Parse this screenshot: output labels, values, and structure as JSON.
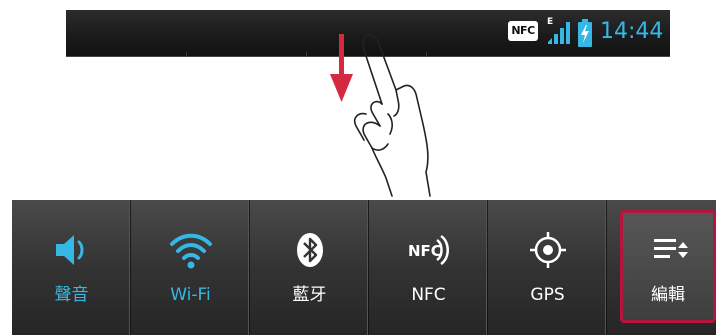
{
  "status_bar": {
    "nfc_label": "NFC",
    "network_type": "E",
    "time": "14:44",
    "accent": "#35b8e6",
    "icons": [
      "nfc-icon",
      "signal-icon",
      "battery-charging-icon"
    ]
  },
  "gesture": {
    "icons": [
      "down-arrow-icon",
      "hand-swipe-icon"
    ],
    "arrow_color": "#d6283f"
  },
  "quick_settings": {
    "tiles": [
      {
        "label": "聲音",
        "icon": "speaker-icon",
        "state": "on"
      },
      {
        "label": "Wi-Fi",
        "icon": "wifi-icon",
        "state": "on"
      },
      {
        "label": "藍牙",
        "icon": "bluetooth-icon",
        "state": "off"
      },
      {
        "label": "NFC",
        "icon": "nfc-icon",
        "state": "off"
      },
      {
        "label": "GPS",
        "icon": "gps-icon",
        "state": "off"
      },
      {
        "label": "編輯",
        "icon": "edit-list-icon",
        "state": "highlighted"
      }
    ],
    "highlight_color": "#b3153d"
  }
}
